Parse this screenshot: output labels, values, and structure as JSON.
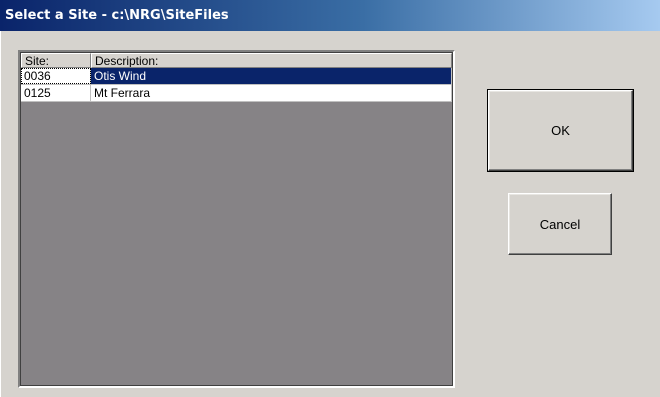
{
  "window": {
    "title": "Select a Site - c:\\NRG\\SiteFiles"
  },
  "list": {
    "columns": [
      "Site:",
      "Description:"
    ],
    "rows": [
      {
        "site": "0036",
        "description": "Otis Wind",
        "selected": true
      },
      {
        "site": "0125",
        "description": "Mt Ferrara",
        "selected": false
      }
    ]
  },
  "buttons": {
    "ok_label": "OK",
    "cancel_label": "Cancel"
  },
  "colors": {
    "selection": "#0a246a",
    "title_start": "#0a246a",
    "title_end": "#a6caf0",
    "face": "#d6d3ce",
    "list_background": "#868386"
  }
}
